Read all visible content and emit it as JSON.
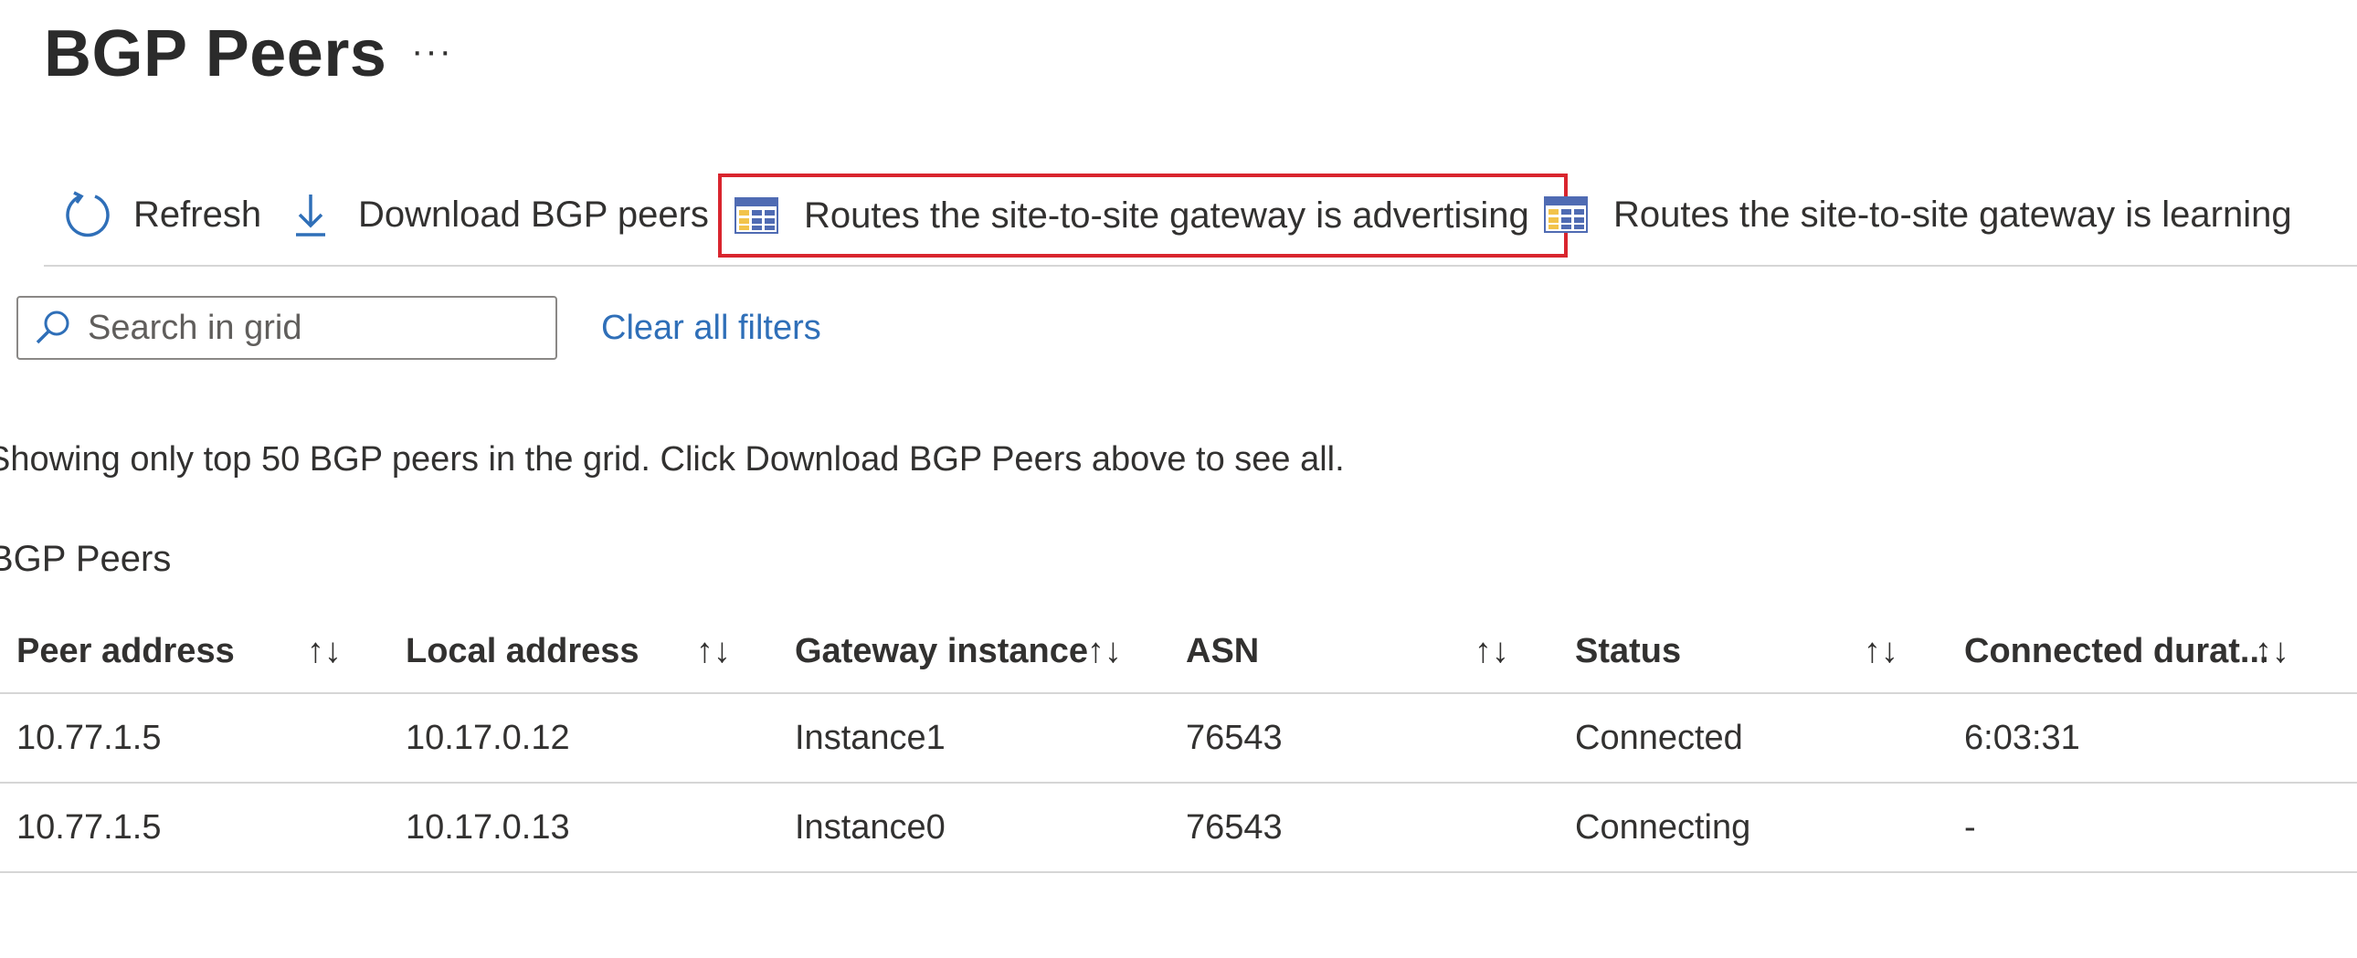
{
  "page": {
    "title": "BGP Peers",
    "more_label": "···"
  },
  "toolbar": {
    "refresh_label": "Refresh",
    "download_label": "Download BGP peers",
    "advertising_label": "Routes the site-to-site gateway is advertising",
    "learning_label": "Routes the site-to-site gateway is learning",
    "highlight_color": "#d9252e"
  },
  "filters": {
    "search_placeholder": "Search in grid",
    "clear_label": "Clear all filters",
    "link_color": "#2f6fb8"
  },
  "info_text": "Showing only top 50 BGP peers in the grid. Click Download BGP Peers above to see all.",
  "grid": {
    "title": "BGP Peers",
    "sort_glyph": "↑↓",
    "columns": [
      {
        "label": "Peer address"
      },
      {
        "label": "Local address"
      },
      {
        "label": "Gateway instance"
      },
      {
        "label": "ASN"
      },
      {
        "label": "Status"
      },
      {
        "label": "Connected durat..."
      }
    ],
    "rows": [
      {
        "peer": "10.77.1.5",
        "local": "10.17.0.12",
        "instance": "Instance1",
        "asn": "76543",
        "status": "Connected",
        "duration": "6:03:31"
      },
      {
        "peer": "10.77.1.5",
        "local": "10.17.0.13",
        "instance": "Instance0",
        "asn": "76543",
        "status": "Connecting",
        "duration": "-"
      }
    ]
  }
}
